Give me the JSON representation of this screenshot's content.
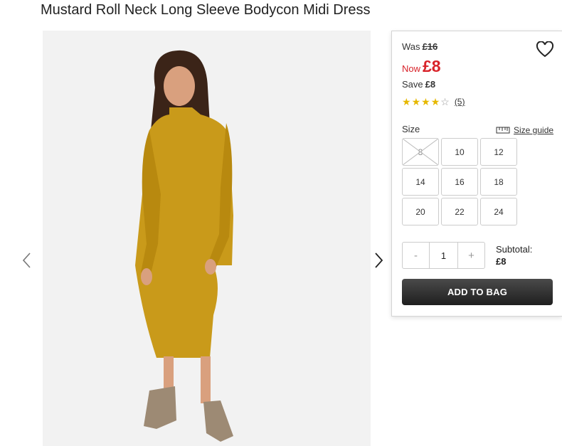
{
  "product": {
    "title": "Mustard Roll Neck Long Sleeve Bodycon Midi Dress"
  },
  "price": {
    "was_label": "Was",
    "was_value": "£16",
    "now_label": "Now",
    "now_value": "£8",
    "save_label": "Save",
    "save_value": "£8",
    "sale_color": "#d8232a"
  },
  "rating": {
    "stars_filled": 4,
    "stars_total": 5,
    "reviews": "(5)",
    "star_color": "#e6b800"
  },
  "size": {
    "label": "Size",
    "guide_label": "Size guide",
    "options": [
      "8",
      "10",
      "12",
      "14",
      "16",
      "18",
      "20",
      "22",
      "24"
    ],
    "unavailable": [
      "8"
    ]
  },
  "quantity": {
    "minus": "-",
    "value": "1",
    "plus": "+"
  },
  "subtotal": {
    "label": "Subtotal:",
    "value": "£8"
  },
  "cta": {
    "add_to_bag": "ADD TO BAG"
  },
  "colors": {
    "dress": "#c99a1a",
    "background": "#f2f2f2"
  },
  "icons": {
    "wishlist": "heart-icon",
    "size_guide": "ruler-icon",
    "prev": "chevron-left-icon",
    "next": "chevron-right-icon"
  }
}
